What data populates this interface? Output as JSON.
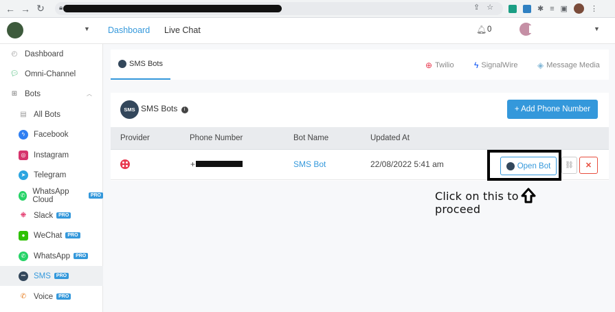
{
  "browser": {
    "back_icon": "arrow-left-icon",
    "forward_icon": "arrow-right-icon",
    "reload_icon": "reload-icon"
  },
  "topnav": {
    "dashboard_label": "Dashboard",
    "livechat_label": "Live Chat",
    "notification_count": "0"
  },
  "sidebar": {
    "items": [
      {
        "label": "Dashboard",
        "icon": "dashboard-icon"
      },
      {
        "label": "Omni-Channel",
        "icon": "chat-bubbles-icon"
      },
      {
        "label": "Bots",
        "icon": "sitemap-icon"
      },
      {
        "label": "All Bots",
        "icon": "list-icon"
      },
      {
        "label": "Facebook",
        "icon": "messenger-icon"
      },
      {
        "label": "Instagram",
        "icon": "instagram-icon"
      },
      {
        "label": "Telegram",
        "icon": "telegram-icon"
      },
      {
        "label": "WhatsApp Cloud",
        "icon": "whatsapp-icon",
        "badge": "PRO"
      },
      {
        "label": "Slack",
        "icon": "slack-icon",
        "badge": "PRO"
      },
      {
        "label": "WeChat",
        "icon": "wechat-icon",
        "badge": "PRO"
      },
      {
        "label": "WhatsApp",
        "icon": "whatsapp-icon",
        "badge": "PRO"
      },
      {
        "label": "SMS",
        "icon": "sms-icon",
        "badge": "PRO"
      },
      {
        "label": "Voice",
        "icon": "phone-icon",
        "badge": "PRO"
      }
    ]
  },
  "tabs": {
    "sms_bots": "SMS Bots",
    "twilio": "Twilio",
    "signalwire": "SignalWire",
    "message_media": "Message Media"
  },
  "card": {
    "icon_text": "SMS",
    "title": "SMS Bots",
    "add_button": "+ Add Phone Number"
  },
  "table": {
    "headers": [
      "Provider",
      "Phone Number",
      "Bot Name",
      "Updated At"
    ],
    "rows": [
      {
        "phone_prefix": "+",
        "bot_name": "SMS Bot",
        "updated_at": "22/08/2022 5:41 am",
        "open_label": "Open Bot"
      }
    ]
  },
  "annotation": {
    "line1": "Click on this to",
    "line2": "proceed"
  },
  "colors": {
    "accent": "#3498db",
    "danger": "#e74c3c",
    "twilio": "#e8394f"
  }
}
